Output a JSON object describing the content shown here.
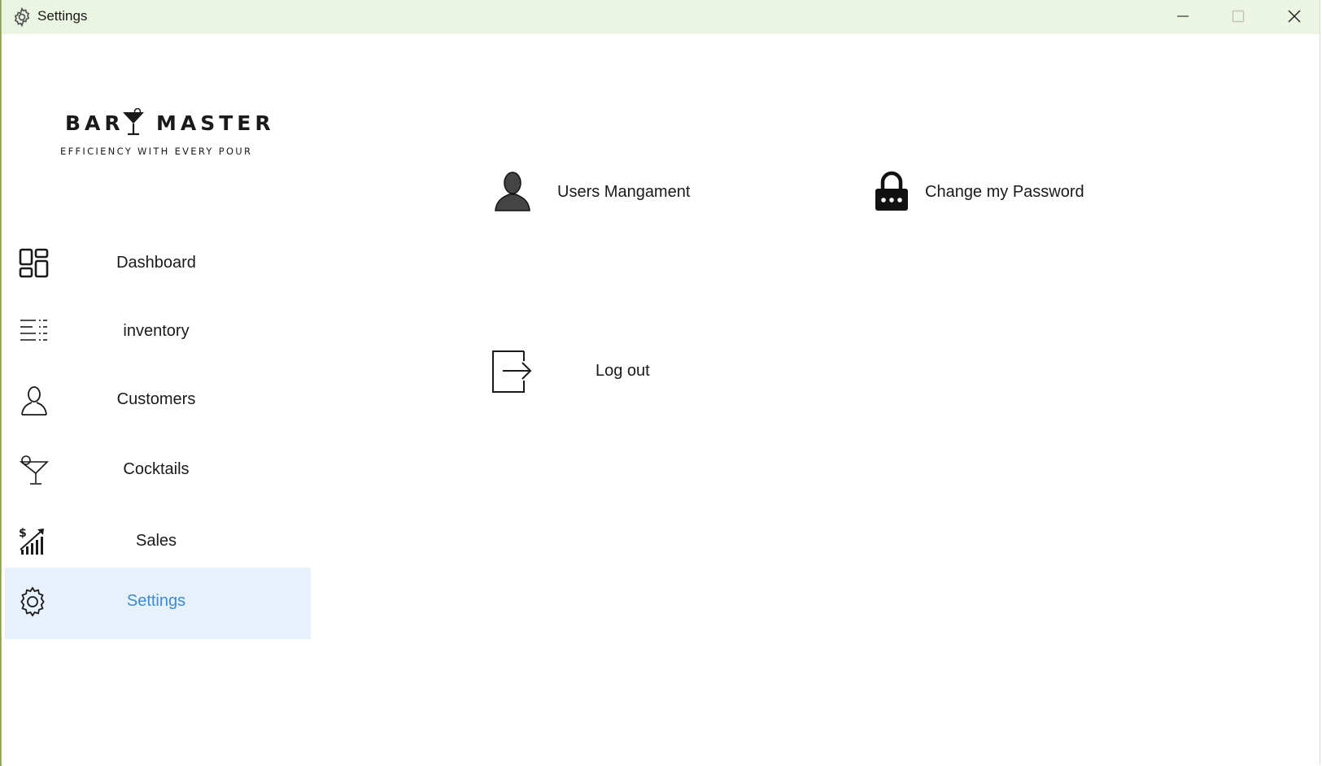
{
  "window": {
    "title": "Settings",
    "icon": "gear-icon"
  },
  "brand": {
    "left_word": "BAR",
    "right_word": "MASTER",
    "tagline": "EFFICIENCY WITH EVERY POUR",
    "logo_icon": "martini-glass-icon"
  },
  "sidebar": {
    "items": [
      {
        "label": "Dashboard",
        "icon": "dashboard-grid-icon",
        "active": false
      },
      {
        "label": "inventory",
        "icon": "list-icon",
        "active": false
      },
      {
        "label": "Customers",
        "icon": "person-outline-icon",
        "active": false
      },
      {
        "label": "Cocktails",
        "icon": "cocktail-glass-icon",
        "active": false
      },
      {
        "label": "Sales",
        "icon": "sales-chart-icon",
        "active": false
      },
      {
        "label": "Settings",
        "icon": "gear-icon",
        "active": true
      }
    ]
  },
  "main": {
    "users_management": {
      "label": "Users Mangament",
      "icon": "user-silhouette-icon"
    },
    "change_password": {
      "label": "Change my Password",
      "icon": "padlock-icon"
    },
    "logout": {
      "label": "Log out",
      "icon": "logout-arrow-icon"
    }
  },
  "colors": {
    "titlebar": "#ecf4e2",
    "active_item_bg": "#e6f1fb",
    "active_item_text": "#3d8ad0"
  }
}
